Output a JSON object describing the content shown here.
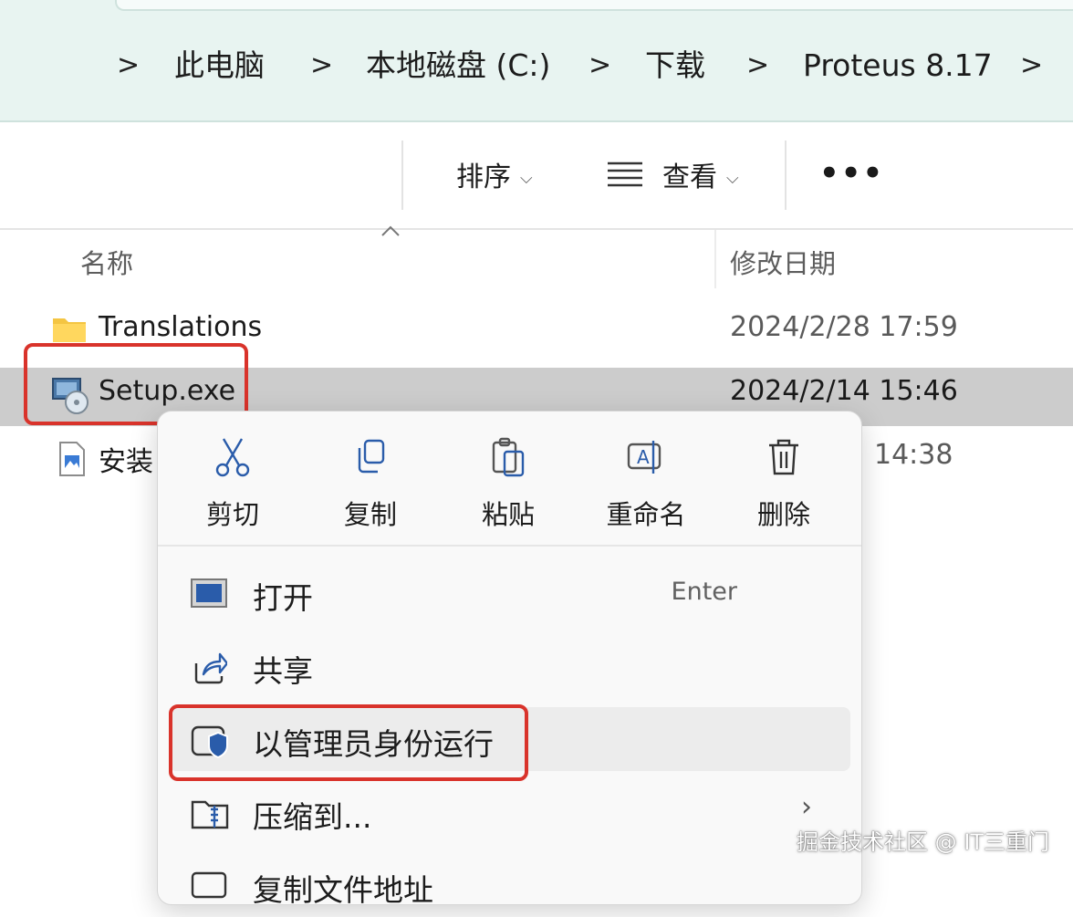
{
  "breadcrumb": {
    "items": [
      "此电脑",
      "本地磁盘 (C:)",
      "下载",
      "Proteus 8.17"
    ],
    "separator": ">"
  },
  "toolbar": {
    "sort_label": "排序",
    "view_label": "查看",
    "more_label": "•••"
  },
  "columns": {
    "name": "名称",
    "modified": "修改日期"
  },
  "files": [
    {
      "name": "Translations",
      "modified": "2024/2/28 17:59",
      "icon": "folder-icon"
    },
    {
      "name": "Setup.exe",
      "modified": "2024/2/14 15:46",
      "icon": "installer-icon",
      "selected": true
    },
    {
      "name": "安装",
      "modified": "14:38",
      "icon": "image-file-icon"
    }
  ],
  "context_menu": {
    "quick_actions": [
      "剪切",
      "复制",
      "粘贴",
      "重命名",
      "删除"
    ],
    "items": [
      {
        "label": "打开",
        "shortcut": "Enter",
        "icon": "open-icon"
      },
      {
        "label": "共享",
        "icon": "share-icon"
      },
      {
        "label": "以管理员身份运行",
        "icon": "shield-run-icon",
        "highlighted": true
      },
      {
        "label": "压缩到...",
        "icon": "zip-icon",
        "submenu": true
      },
      {
        "label": "复制文件地址",
        "icon": "copy-path-icon"
      }
    ]
  },
  "watermark": "掘金技术社区 @ IT三重门",
  "colors": {
    "highlight_box": "#d9332b",
    "selected_row": "#cccccc",
    "address_band": "#e8f4f1"
  }
}
